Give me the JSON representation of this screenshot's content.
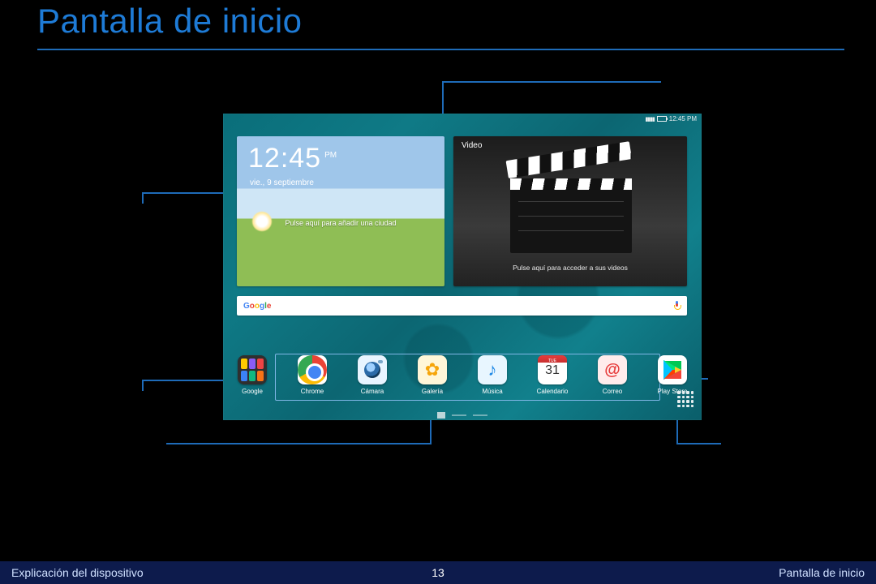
{
  "title": "Pantalla de inicio",
  "footer": {
    "left": "Explicación del dispositivo",
    "page": "13",
    "right": "Pantalla de inicio"
  },
  "status": {
    "time": "12:45 PM"
  },
  "clock": {
    "time": "12:45",
    "ampm": "PM",
    "date": "vie., 9 septiembre",
    "hint": "Pulse aquí para añadir una ciudad"
  },
  "video": {
    "title": "Video",
    "hint": "Pulse aquí para acceder a sus videos"
  },
  "search": {
    "logo": "Google"
  },
  "calendar": {
    "day_label": "TUE",
    "day_num": "31"
  },
  "apps": [
    {
      "id": "google-folder",
      "label": "Google"
    },
    {
      "id": "chrome",
      "label": "Chrome"
    },
    {
      "id": "camera",
      "label": "Cámara"
    },
    {
      "id": "gallery",
      "label": "Galería"
    },
    {
      "id": "music",
      "label": "Música"
    },
    {
      "id": "calendar",
      "label": "Calendario"
    },
    {
      "id": "mail",
      "label": "Correo"
    },
    {
      "id": "play-store",
      "label": "Play Store"
    }
  ]
}
